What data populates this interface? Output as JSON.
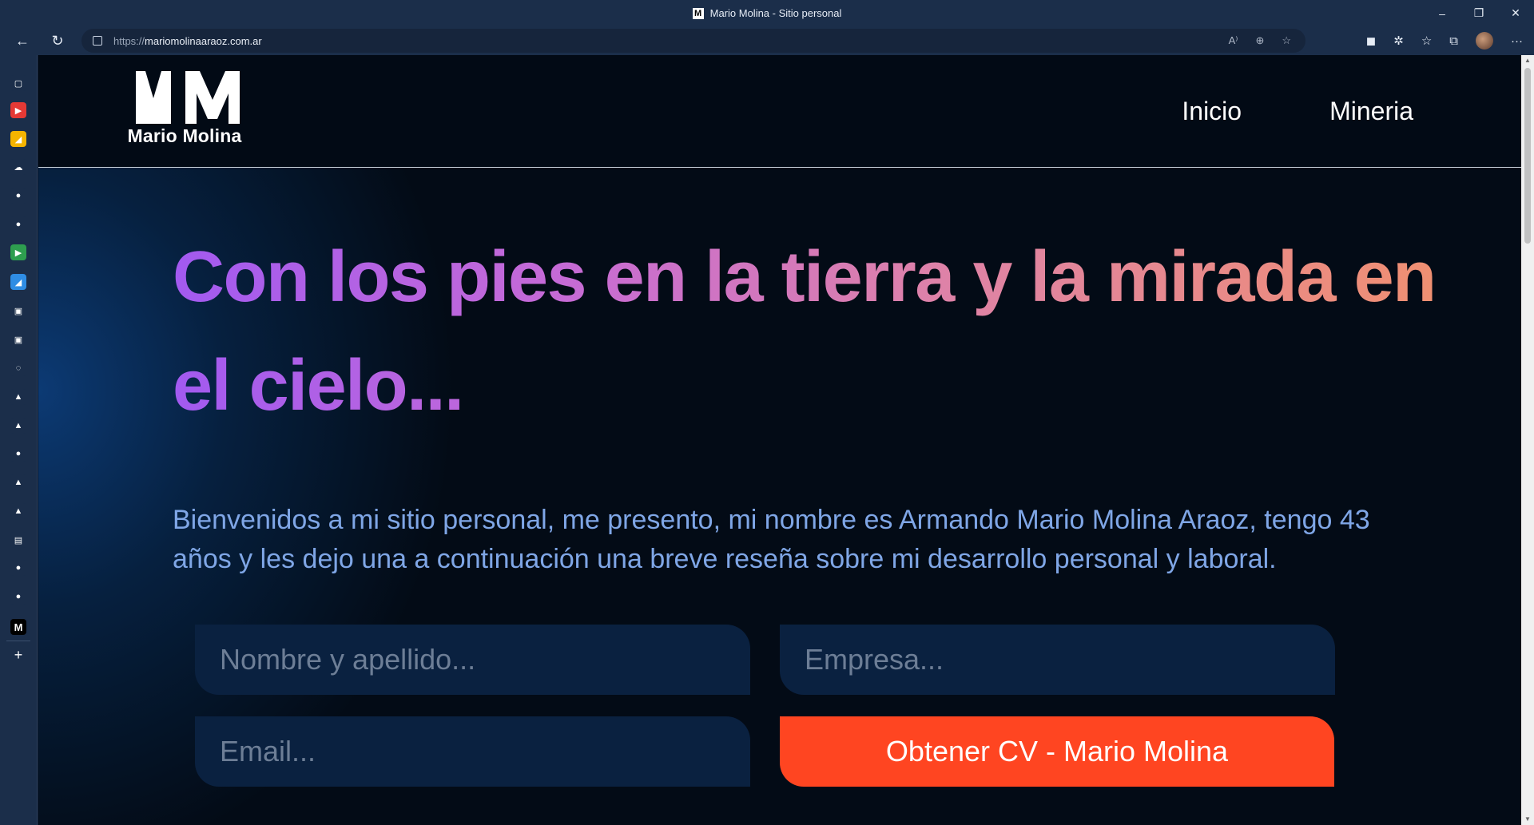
{
  "window": {
    "title": "Mario Molina - Sitio personal",
    "favicon_letter": "M",
    "controls": {
      "minimize": "–",
      "restore": "❐",
      "close": "✕"
    }
  },
  "browser": {
    "back": "←",
    "reload": "↻",
    "url_scheme": "https://",
    "url_host": "mariomolinaaraoz.com.ar",
    "address_icons": [
      "read-aloud-icon",
      "zoom-icon",
      "favorite-add-icon"
    ],
    "toolbar_icons": [
      "shield-extension-icon",
      "extensions-icon",
      "favorites-icon",
      "collections-icon",
      "profile-avatar",
      "more-menu-icon"
    ],
    "more_glyph": "···"
  },
  "sidebar": {
    "items": [
      {
        "name": "tabs-icon",
        "color": "#1b2e4a",
        "glyph": "▢"
      },
      {
        "name": "youtube-icon",
        "color": "#e53935",
        "glyph": "▶"
      },
      {
        "name": "app-yellow-icon",
        "color": "#f5b400",
        "glyph": "◢"
      },
      {
        "name": "cloud-icon",
        "color": "#1b2e4a",
        "glyph": "☁"
      },
      {
        "name": "github-icon",
        "color": "#1b2e4a",
        "glyph": "●"
      },
      {
        "name": "github-dim-icon",
        "color": "#1b2e4a",
        "glyph": "●"
      },
      {
        "name": "play-green-icon",
        "color": "#2e9e4f",
        "glyph": "▶"
      },
      {
        "name": "app-blue-icon",
        "color": "#2f8de4",
        "glyph": "◢"
      },
      {
        "name": "image-icon",
        "color": "#1b2e4a",
        "glyph": "▣"
      },
      {
        "name": "image-icon-2",
        "color": "#1b2e4a",
        "glyph": "▣"
      },
      {
        "name": "circle-blue-icon",
        "color": "#1b2e4a",
        "glyph": "◌"
      },
      {
        "name": "triangle-icon",
        "color": "#1b2e4a",
        "glyph": "▲"
      },
      {
        "name": "triangle-icon-2",
        "color": "#1b2e4a",
        "glyph": "▲"
      },
      {
        "name": "circle-gray-icon",
        "color": "#1b2e4a",
        "glyph": "●"
      },
      {
        "name": "triangle-icon-3",
        "color": "#1b2e4a",
        "glyph": "▲"
      },
      {
        "name": "triangle-icon-4",
        "color": "#1b2e4a",
        "glyph": "▲"
      },
      {
        "name": "document-icon",
        "color": "#1b2e4a",
        "glyph": "▤"
      },
      {
        "name": "circle-gray-icon-2",
        "color": "#1b2e4a",
        "glyph": "●"
      },
      {
        "name": "circle-white-icon",
        "color": "#1b2e4a",
        "glyph": "●"
      },
      {
        "name": "mario-molina-tab-icon",
        "color": "#000000",
        "glyph": "M"
      }
    ],
    "add": "+"
  },
  "site": {
    "logo_name": "Mario Molina",
    "nav": [
      "Inicio",
      "Mineria"
    ],
    "hero_title": "Con los pies en la tierra y la mirada en el cielo...",
    "intro": "Bienvenidos a mi sitio personal, me presento, mi nombre es Armando Mario Molina Araoz, tengo 43 años y les dejo una a continuación una breve reseña sobre mi desarrollo personal y laboral.",
    "form": {
      "name_placeholder": "Nombre y apellido...",
      "company_placeholder": "Empresa...",
      "email_placeholder": "Email...",
      "submit_label": "Obtener CV - Mario Molina"
    },
    "colors": {
      "accent": "#ff4521",
      "intro_text": "#7fa6e6",
      "gradient_start": "#a25af0",
      "gradient_end": "#f09070"
    }
  }
}
